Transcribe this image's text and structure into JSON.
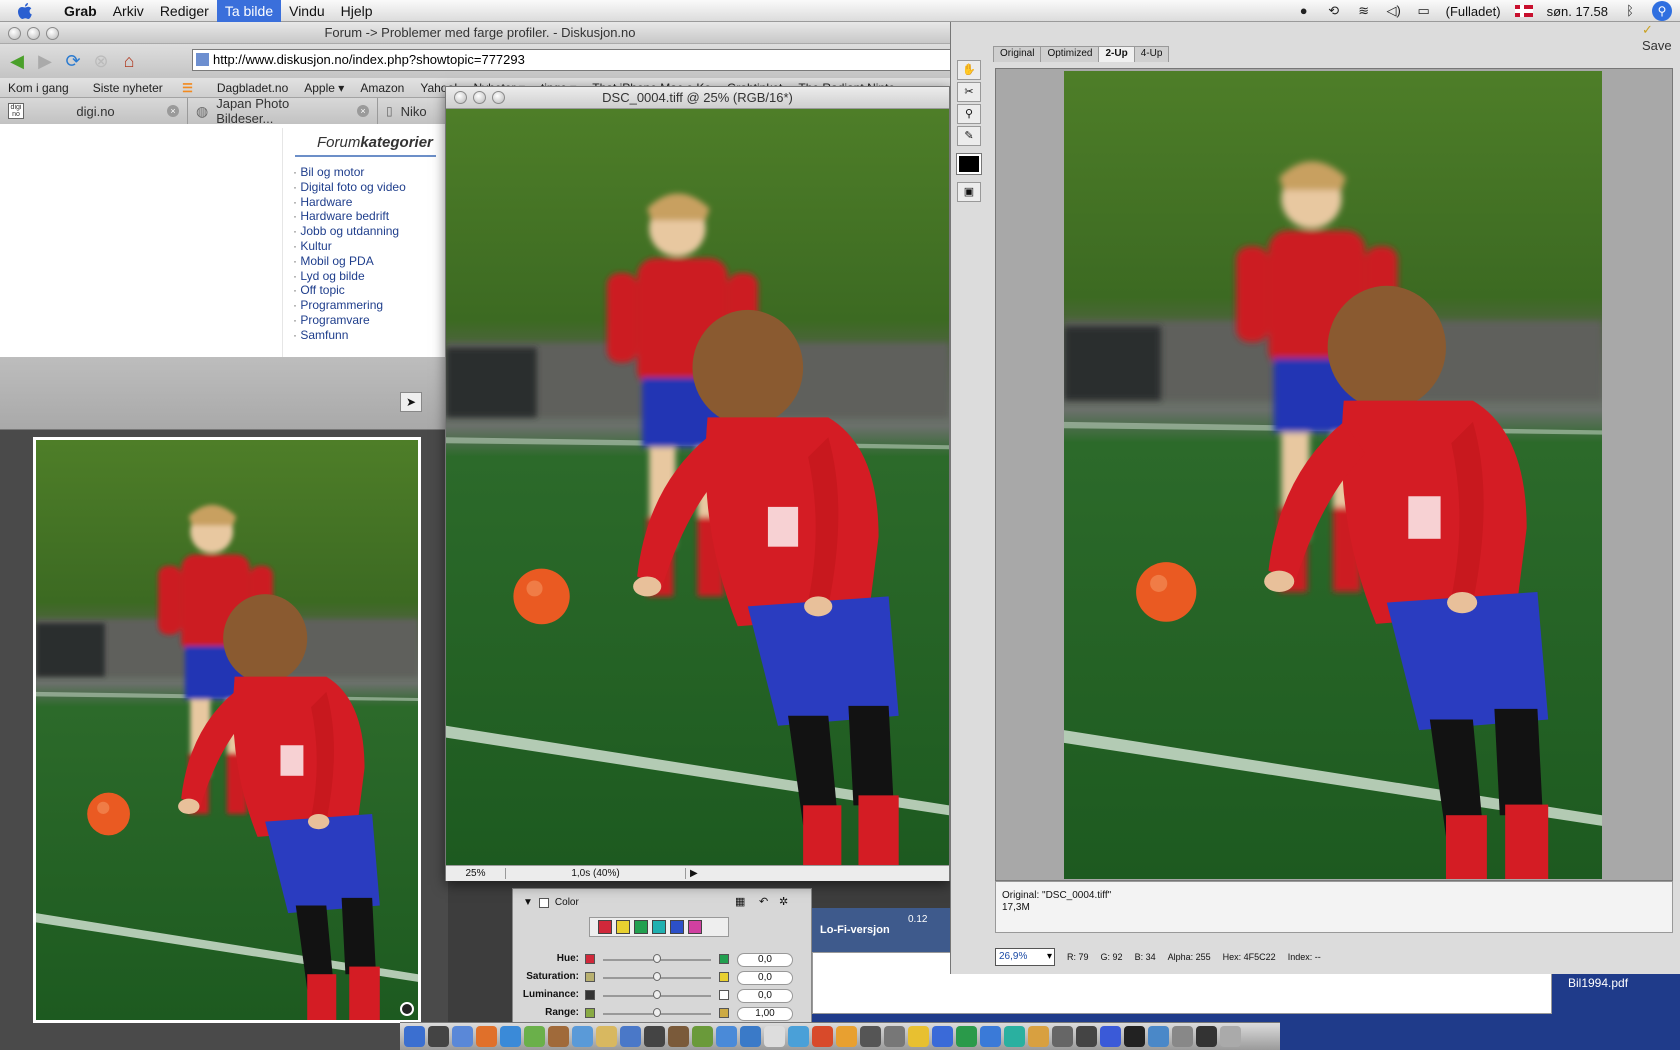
{
  "menubar": {
    "app": "Grab",
    "items": [
      "Arkiv",
      "Rediger",
      "Ta bilde",
      "Vindu",
      "Hjelp"
    ],
    "battery": "(Fulladet)",
    "clock": "søn. 17.58"
  },
  "browser": {
    "title": "Forum -> Problemer med farge profiler. - Diskusjon.no",
    "url": "http://www.diskusjon.no/index.php?showtopic=777293",
    "bookmarks": [
      "Kom i gang",
      "Siste nyheter",
      "Dagbladet.no",
      "Apple ▾",
      "Amazon",
      "Yahoo!",
      "Nyheter ▾",
      "tinge ▾",
      "That iPhone Mac o Ko",
      "Grahtinket",
      "The Radiant Ninte"
    ],
    "tabs": [
      {
        "label": "digi.no",
        "icon_text": "digi no"
      },
      {
        "label": "Japan Photo Bildeser..."
      },
      {
        "label": "Niko"
      }
    ],
    "forum": {
      "title_light": "Forum",
      "title_bold": "kategorier",
      "links": [
        "Bil og motor",
        "Digital foto og video",
        "Hardware",
        "Hardware bedrift",
        "Jobb og utdanning",
        "Kultur",
        "Mobil og PDA",
        "Lyd og bilde",
        "Off topic",
        "Programmering",
        "Programvare",
        "Samfunn"
      ]
    }
  },
  "psdoc": {
    "title": "DSC_0004.tiff @ 25% (RGB/16*)",
    "zoom": "25%",
    "timing": "1,0s (40%)"
  },
  "colorpanel": {
    "title": "Color",
    "swatches": [
      "#d0283a",
      "#e8d030",
      "#22a050",
      "#20b0b0",
      "#2c50c8",
      "#d040a0"
    ],
    "rows": [
      {
        "label": "Hue:",
        "value": "0,0",
        "left": "#d0283a",
        "right": "#22a050"
      },
      {
        "label": "Saturation:",
        "value": "0,0",
        "left": "#b8b070",
        "right": "#e8d030"
      },
      {
        "label": "Luminance:",
        "value": "0,0",
        "left": "#333333",
        "right": "#ffffff"
      },
      {
        "label": "Range:",
        "value": "1,00",
        "left": "#88aa44",
        "right": "#ccaa44"
      }
    ]
  },
  "lofi": {
    "label": "Lo-Fi-versjon",
    "extra": "0.12"
  },
  "sfw": {
    "tabs": [
      "Original",
      "Optimized",
      "2-Up",
      "4-Up"
    ],
    "active_tab": "2-Up",
    "info_name": "Original: \"DSC_0004.tiff\"",
    "info_size": "17,3M",
    "zoom": "26,9%",
    "readout": {
      "R": "79",
      "G": "92",
      "B": "34",
      "Alpha": "255",
      "Hex": "4F5C22",
      "Index": "--"
    },
    "save_label": "Save"
  },
  "desktop": {
    "file": "Bil1994.pdf"
  },
  "colors": {
    "accent": "#3a6fdb",
    "grass": "#2f7a2a",
    "shirt": "#cc1c24",
    "shorts": "#2436b4",
    "ball": "#ea5a22"
  }
}
